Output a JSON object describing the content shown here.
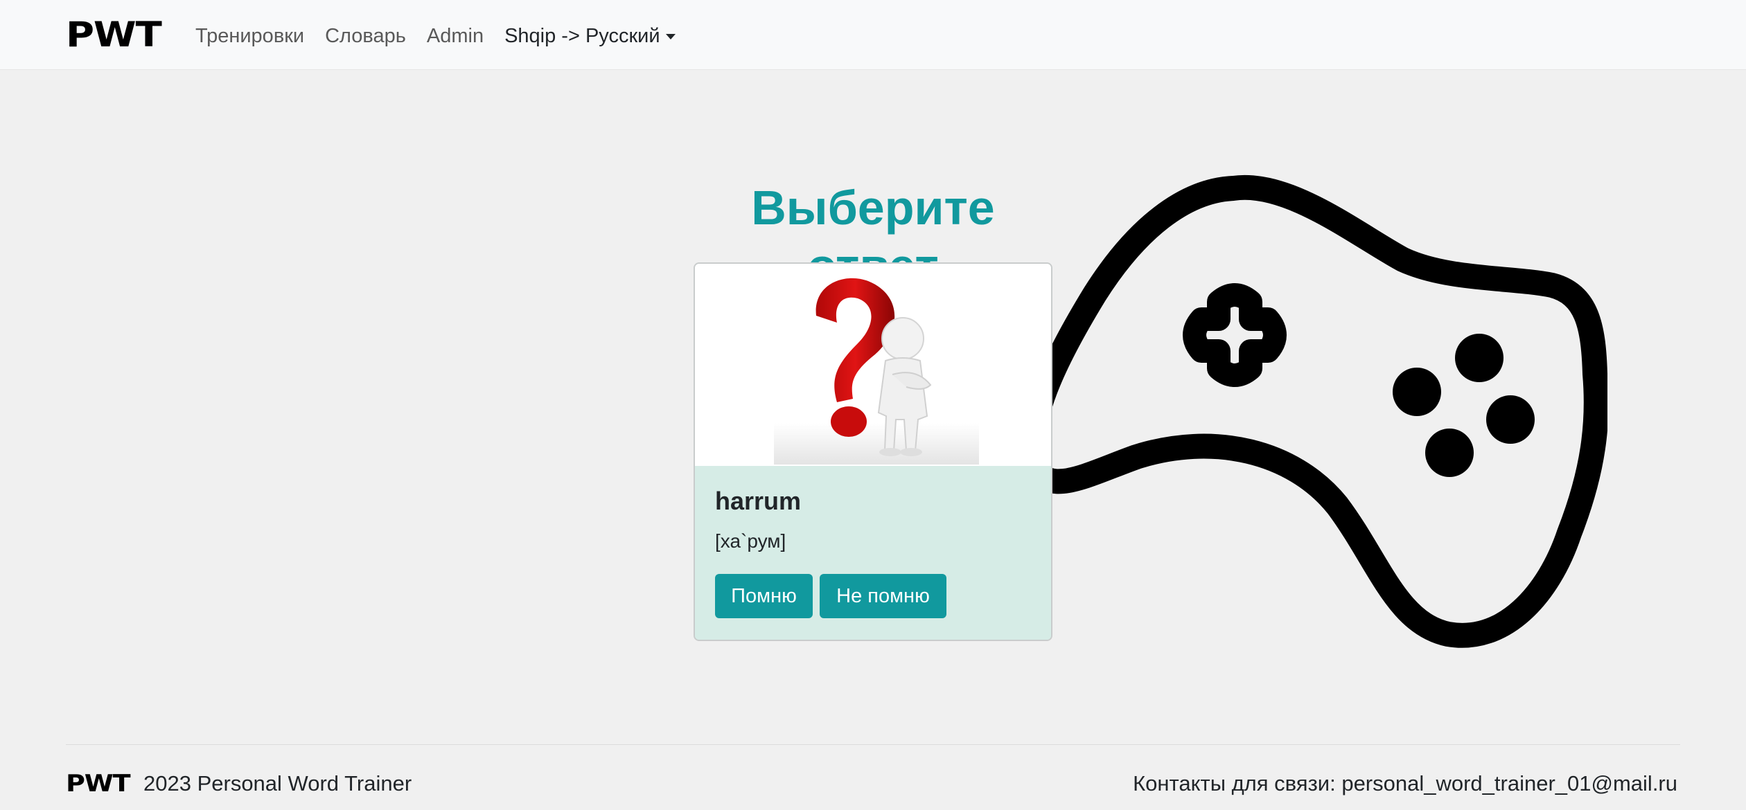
{
  "navbar": {
    "brand": "PWT",
    "links": [
      "Тренировки",
      "Словарь",
      "Admin"
    ],
    "language_dropdown": "Shqip -> Русский"
  },
  "main": {
    "heading": "Выберите ответ",
    "card": {
      "word": "harrum",
      "transcription": "[ха`рум]",
      "remember_button": "Помню",
      "forget_button": "Не помню"
    }
  },
  "footer": {
    "brand": "PWT",
    "text": "2023 Personal Word Trainer",
    "contacts": "Контакты для связи: personal_word_trainer_01@mail.ru"
  },
  "icons": {
    "gamepad": "gamepad-icon",
    "question": "question-person-image",
    "dropdown": "caret-down-icon"
  },
  "colors": {
    "accent": "#11999e",
    "card_body": "#d6ece6",
    "page_bg": "#f0f0f0",
    "navbar_bg": "#f8f9fa",
    "question_mark": "#d40f0f"
  }
}
